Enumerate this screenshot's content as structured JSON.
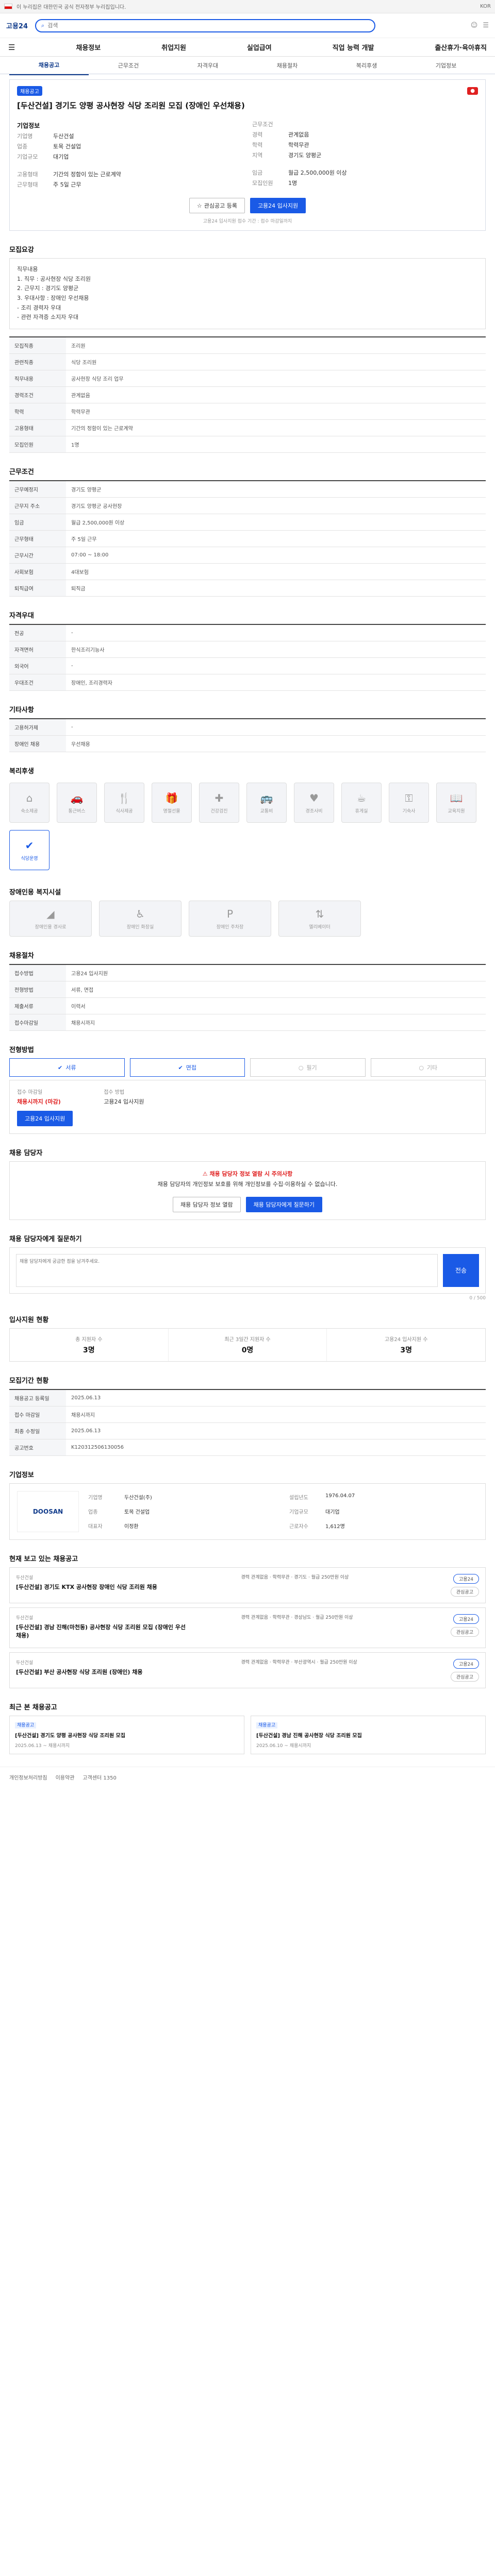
{
  "topbar": {
    "gov_text": "이 누리집은 대한민국 공식 전자정부 누리집입니다.",
    "lang": "KOR"
  },
  "header": {
    "logo": "고용24",
    "search_hint": "검색"
  },
  "gnb": [
    "채용정보",
    "취업지원",
    "실업급여",
    "직업 능력 개발",
    "출산휴가·육아휴직"
  ],
  "tabs": [
    "채용공고",
    "근무조건",
    "자격우대",
    "채용절차",
    "복리후생",
    "기업정보"
  ],
  "job": {
    "badge": "채용공고",
    "title": "[두산건설] 경기도 양평 공사현장 식당 조리원 모집 (장애인 우선채용)",
    "company_label": "기업정보",
    "company_value": "두산건설",
    "left": [
      {
        "k": "기업명",
        "v": "두산건설"
      },
      {
        "k": "업종",
        "v": "토목 건설업"
      },
      {
        "k": "기업규모",
        "v": "대기업"
      }
    ],
    "right": [
      {
        "k": "근무조건",
        "v": ""
      },
      {
        "k": "경력",
        "v": "관계없음"
      },
      {
        "k": "학력",
        "v": "학력무관"
      },
      {
        "k": "지역",
        "v": "경기도 양평군"
      }
    ],
    "l2": [
      {
        "k": "고용형태",
        "v": "기간의 정함이 있는 근로계약"
      },
      {
        "k": "근무형태",
        "v": "주 5일 근무"
      }
    ],
    "r2": [
      {
        "k": "임금",
        "v": "월급 2,500,000원 이상"
      },
      {
        "k": "모집인원",
        "v": "1명"
      }
    ],
    "btn_scrap": "관심공고 등록",
    "btn_apply": "고용24 입사지원",
    "note": "고용24 입사지원 접수 기간 : 접수 마감일까지"
  },
  "sections": {
    "detail_title": "모집요강",
    "detail_text": [
      "직무내용",
      "1. 직무 : 공사현장 식당 조리원",
      "2. 근무지 : 경기도 양평군",
      "3. 우대사항 : 장애인 우선채용",
      "- 조리 경력자 우대",
      "- 관련 자격증 소지자 우대"
    ],
    "work_title": "근무조건",
    "qual_title": "자격우대",
    "etc_title": "기타사항",
    "welfare_title": "복리후생",
    "disability_title": "장애인용 복지시설",
    "process_title": "채용절차",
    "method_title": "전형방법",
    "caution_title": "채용 담당자",
    "qna_title": "채용 담당자에게 질문하기",
    "stats_title": "입사지원 현황",
    "period_title": "모집기간 현황",
    "company_title": "기업정보",
    "related_title": "현재 보고 있는 채용공고",
    "recent_title": "최근 본 채용공고"
  },
  "recruit_table": [
    {
      "k": "모집직종",
      "v": "조리원"
    },
    {
      "k": "관련직종",
      "v": "식당 조리원"
    },
    {
      "k": "직무내용",
      "v": "공사현장 식당 조리 업무"
    },
    {
      "k": "경력조건",
      "v": "관계없음"
    },
    {
      "k": "학력",
      "v": "학력무관"
    },
    {
      "k": "고용형태",
      "v": "기간의 정함이 있는 근로계약"
    },
    {
      "k": "모집인원",
      "v": "1명"
    }
  ],
  "work_table": [
    {
      "k": "근무예정지",
      "v": "경기도 양평군"
    },
    {
      "k": "근무지 주소",
      "v": "경기도 양평군 공사현장"
    },
    {
      "k": "임금",
      "v": "월급 2,500,000원 이상"
    },
    {
      "k": "근무형태",
      "v": "주 5일 근무"
    },
    {
      "k": "근무시간",
      "v": "07:00 ~ 18:00"
    },
    {
      "k": "사회보험",
      "v": "4대보험"
    },
    {
      "k": "퇴직급여",
      "v": "퇴직금"
    }
  ],
  "qual_table": [
    {
      "k": "전공",
      "v": "-"
    },
    {
      "k": "자격면허",
      "v": "한식조리기능사"
    },
    {
      "k": "외국어",
      "v": "-"
    },
    {
      "k": "우대조건",
      "v": "장애인, 조리경력자"
    }
  ],
  "etc_table": [
    {
      "k": "고용허가제",
      "v": "-"
    },
    {
      "k": "장애인 채용",
      "v": "우선채용"
    }
  ],
  "welfare": [
    {
      "icon": "home-icon",
      "label": "숙소제공",
      "on": false
    },
    {
      "icon": "car-icon",
      "label": "통근버스",
      "on": false
    },
    {
      "icon": "meal-icon",
      "label": "식사제공",
      "on": false
    },
    {
      "icon": "gift-icon",
      "label": "명절선물",
      "on": false
    },
    {
      "icon": "medical-icon",
      "label": "건강검진",
      "on": false
    },
    {
      "icon": "bus-icon",
      "label": "교통비",
      "on": false
    },
    {
      "icon": "child-icon",
      "label": "경조사비",
      "on": false
    },
    {
      "icon": "coffee-icon",
      "label": "휴게실",
      "on": false
    },
    {
      "icon": "key-icon",
      "label": "기숙사",
      "on": false
    },
    {
      "icon": "book-icon",
      "label": "교육지원",
      "on": false
    },
    {
      "icon": "check-icon",
      "label": "식당운영",
      "on": true
    }
  ],
  "disability": [
    {
      "icon": "ramp-icon",
      "label": "장애인용 경사로"
    },
    {
      "icon": "wheelchair-icon",
      "label": "장애인 화장실"
    },
    {
      "icon": "parking-icon",
      "label": "장애인 주차장"
    },
    {
      "icon": "elevator-icon",
      "label": "엘리베이터"
    }
  ],
  "process_table": [
    {
      "k": "접수방법",
      "v": "고용24 입사지원"
    },
    {
      "k": "전형방법",
      "v": "서류, 면접"
    },
    {
      "k": "제출서류",
      "v": "이력서"
    },
    {
      "k": "접수마감일",
      "v": "채용시까지"
    }
  ],
  "methods": [
    {
      "label": "서류",
      "on": true
    },
    {
      "label": "면접",
      "on": true
    },
    {
      "label": "필기",
      "on": false
    },
    {
      "label": "기타",
      "on": false
    }
  ],
  "apply": {
    "k1": "접수 마감일",
    "v1": "채용시까지 (마감)",
    "k2": "접수 방법",
    "v2": "고용24 입사지원",
    "btn": "고용24 입사지원"
  },
  "caution": {
    "headline": "채용 담당자 정보 열람 시 주의사항",
    "text": "채용 담당자의 개인정보 보호를 위해 개인정보를 수집·이용하실 수 없습니다.",
    "btn1": "채용 담당자 정보 열람",
    "btn2": "채용 담당자에게 질문하기"
  },
  "qna": {
    "placeholder": "채용 담당자에게 궁금한 점을 남겨주세요.",
    "send": "전송",
    "count": "0 / 500"
  },
  "stats": [
    {
      "k": "총 지원자 수",
      "v": "3명"
    },
    {
      "k": "최근 3일간 지원자 수",
      "v": "0명"
    },
    {
      "k": "고용24 입사지원 수",
      "v": "3명"
    }
  ],
  "period_table": [
    {
      "k": "채용공고 등록일",
      "v": "2025.06.13"
    },
    {
      "k": "접수 마감일",
      "v": "채용시까지"
    },
    {
      "k": "최종 수정일",
      "v": "2025.06.13"
    },
    {
      "k": "공고번호",
      "v": "K120312506130056"
    }
  ],
  "company": {
    "logo": "DOOSAN",
    "rows": [
      {
        "k": "기업명",
        "v": "두산건설(주)"
      },
      {
        "k": "설립년도",
        "v": "1976.04.07"
      },
      {
        "k": "업종",
        "v": "토목 건설업"
      },
      {
        "k": "기업규모",
        "v": "대기업"
      },
      {
        "k": "대표자",
        "v": "이정환"
      },
      {
        "k": "근로자수",
        "v": "1,612명"
      }
    ]
  },
  "related": [
    {
      "cname": "두산건설",
      "title": "[두산건설] 경기도 KTX 공사현장 장애인 식당 조리원 채용",
      "meta": "경력 관계없음 · 학력무관 · 경기도 · 월급 250만원 이상",
      "pill1": "고용24",
      "pill2": "관심공고"
    },
    {
      "cname": "두산건설",
      "title": "[두산건설] 경남 진해(마천동) 공사현장 식당 조리원 모집 (장애인 우선채용)",
      "meta": "경력 관계없음 · 학력무관 · 경상남도 · 월급 250만원 이상",
      "pill1": "고용24",
      "pill2": "관심공고"
    },
    {
      "cname": "두산건설",
      "title": "[두산건설] 부산 공사현장 식당 조리원 (장애인) 채용",
      "meta": "경력 관계없음 · 학력무관 · 부산광역시 · 월급 250만원 이상",
      "pill1": "고용24",
      "pill2": "관심공고"
    }
  ],
  "recent": [
    {
      "tag": "채용공고",
      "title": "[두산건설] 경기도 양평 공사현장 식당 조리원 모집",
      "date": "2025.06.13 ~ 채용시까지"
    },
    {
      "tag": "채용공고",
      "title": "[두산건설] 경남 진해 공사현장 식당 조리원 모집",
      "date": "2025.06.10 ~ 채용시까지"
    }
  ],
  "footer": [
    "개인정보처리방침",
    "이용약관",
    "고객센터 1350"
  ]
}
